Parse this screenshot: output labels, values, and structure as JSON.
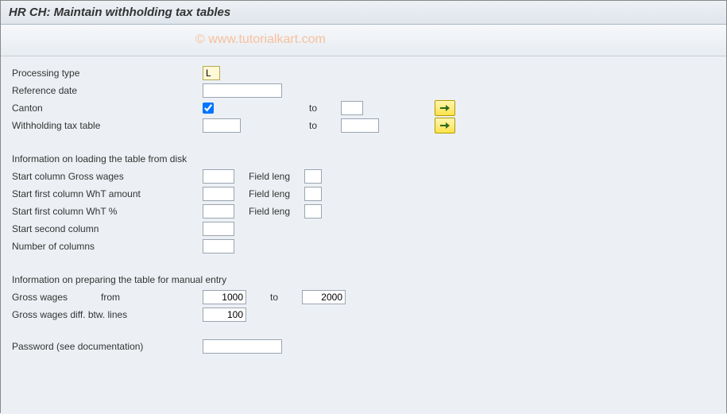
{
  "header": {
    "title": "HR CH: Maintain withholding tax tables"
  },
  "watermark": "© www.tutorialkart.com",
  "labels": {
    "processing_type": "Processing type",
    "reference_date": "Reference date",
    "canton": "Canton",
    "withholding_tax_table": "Withholding tax table",
    "to": "to",
    "section_load": "Information on loading the table from disk",
    "start_gross_wages": "Start column Gross wages",
    "start_wht_amount": "Start first column WhT amount",
    "start_wht_pct": "Start first column WhT %",
    "start_second_col": "Start second column",
    "number_cols": "Number of columns",
    "field_leng": "Field leng",
    "section_prepare": "Information on preparing the table for manual entry",
    "gross_wages": "Gross wages",
    "from": "from",
    "gross_wages_diff": "Gross wages diff. btw. lines",
    "password": "Password (see documentation)"
  },
  "values": {
    "processing_type": "L",
    "reference_date": "",
    "canton_checked": true,
    "canton_from": "",
    "canton_to": "",
    "wht_from": "",
    "wht_to": "",
    "start_gross_wages": "",
    "fl_gross_wages": "",
    "start_wht_amount": "",
    "fl_wht_amount": "",
    "start_wht_pct": "",
    "fl_wht_pct": "",
    "start_second_col": "",
    "number_cols": "",
    "gross_wages_from": "1000",
    "gross_wages_to": "2000",
    "gross_wages_diff": "100",
    "password": ""
  }
}
